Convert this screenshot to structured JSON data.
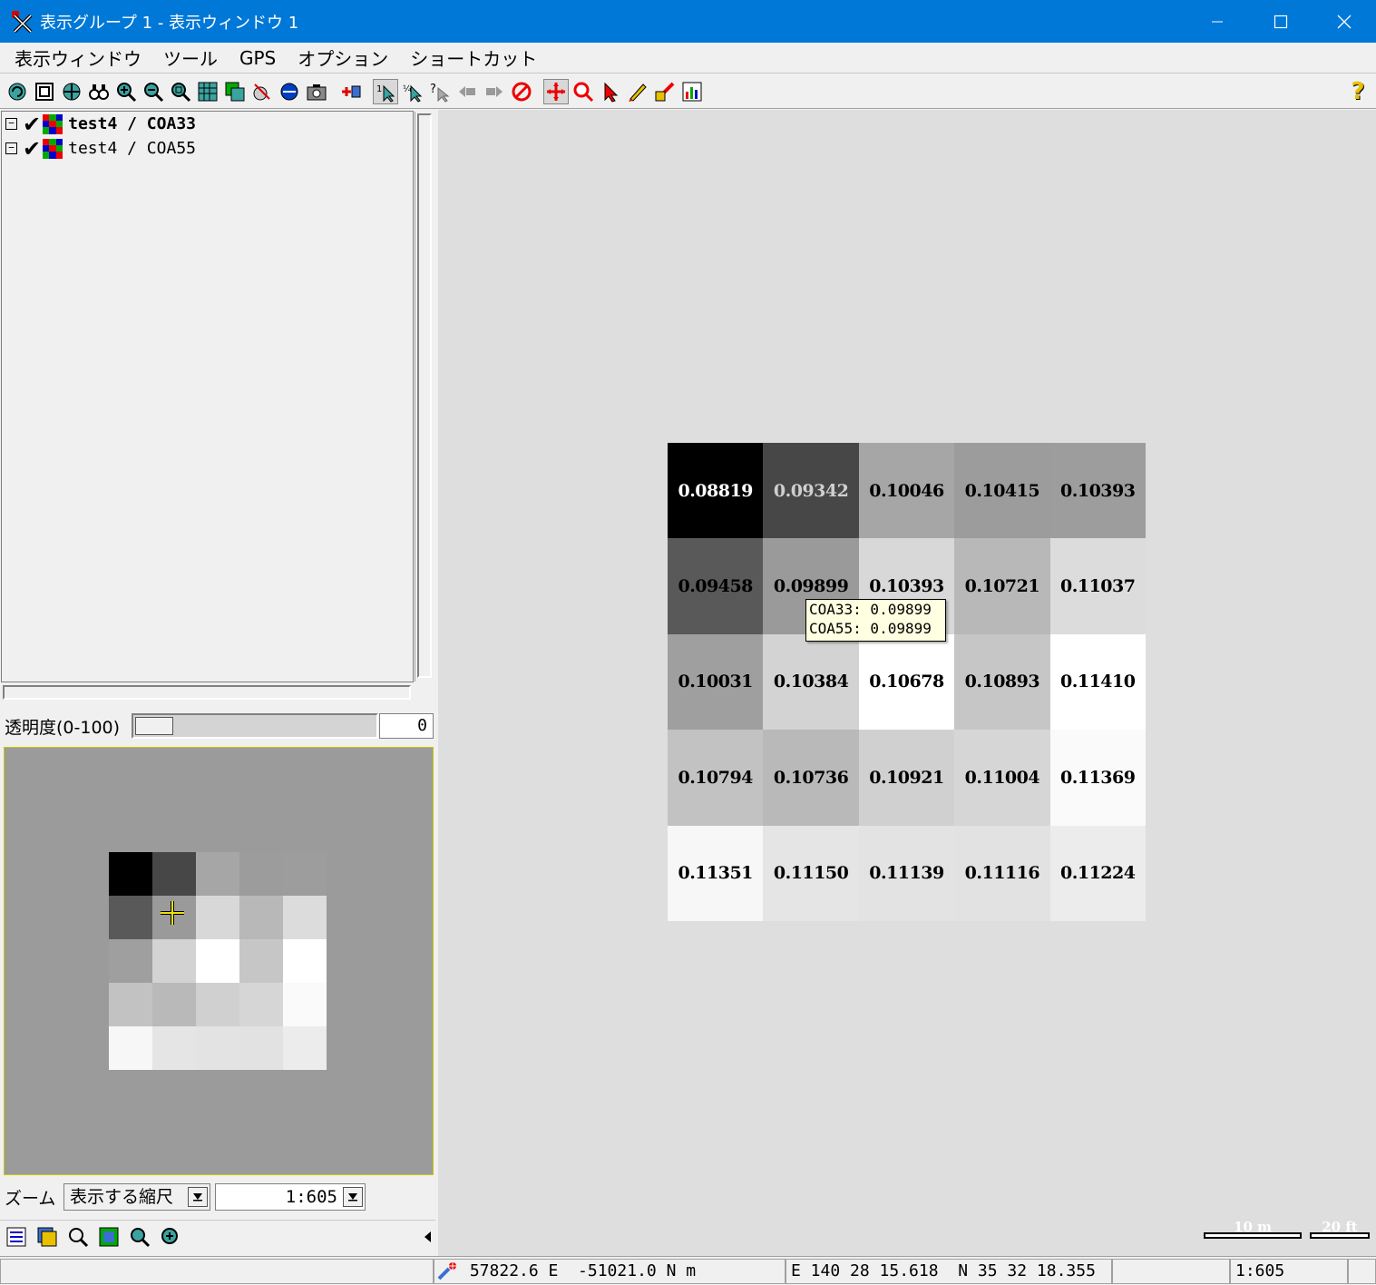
{
  "window": {
    "title": "表示グループ 1 - 表示ウィンドウ 1"
  },
  "menu": [
    "表示ウィンドウ",
    "ツール",
    "GPS",
    "オプション",
    "ショートカット"
  ],
  "layers": [
    {
      "label": "test4 / COA33",
      "checked": true,
      "bold": true
    },
    {
      "label": "test4 / COA55",
      "checked": true,
      "bold": false
    }
  ],
  "opacity": {
    "label": "透明度(0-100)",
    "value": "0"
  },
  "zoom": {
    "label": "ズーム",
    "mode": "表示する縮尺",
    "scale": "1:605"
  },
  "grid": {
    "values": [
      [
        "0.08819",
        "0.09342",
        "0.10046",
        "0.10415",
        "0.10393"
      ],
      [
        "0.09458",
        "0.09899",
        "0.10393",
        "0.10721",
        "0.11037"
      ],
      [
        "0.10031",
        "0.10384",
        "0.10678",
        "0.10893",
        "0.11410"
      ],
      [
        "0.10794",
        "0.10736",
        "0.10921",
        "0.11004",
        "0.11369"
      ],
      [
        "0.11351",
        "0.11150",
        "0.11139",
        "0.11116",
        "0.11224"
      ]
    ],
    "colors": [
      [
        "#000000",
        "#474747",
        "#a6a6a6",
        "#9c9c9c",
        "#9d9d9d"
      ],
      [
        "#595959",
        "#9a9a9a",
        "#d8d8d8",
        "#b8b8b8",
        "#dcdcdc"
      ],
      [
        "#9f9f9f",
        "#d3d3d3",
        "#ffffff",
        "#c6c6c6",
        "#ffffff"
      ],
      [
        "#c2c2c2",
        "#b9b9b9",
        "#d0d0d0",
        "#d6d6d6",
        "#fafafa"
      ],
      [
        "#f7f7f7",
        "#e5e5e5",
        "#e3e3e3",
        "#e2e2e2",
        "#ececec"
      ]
    ],
    "text_colors": [
      [
        "#ffffff",
        "#cfcfcf",
        "#000000",
        "#000000",
        "#000000"
      ],
      [
        "#000000",
        "#000000",
        "#000000",
        "#000000",
        "#000000"
      ],
      [
        "#000000",
        "#000000",
        "#000000",
        "#000000",
        "#000000"
      ],
      [
        "#000000",
        "#000000",
        "#000000",
        "#000000",
        "#000000"
      ],
      [
        "#000000",
        "#000000",
        "#000000",
        "#000000",
        "#000000"
      ]
    ],
    "overview_colors": [
      [
        "#000000",
        "#474747",
        "#a6a6a6",
        "#9c9c9c",
        "#9d9d9d"
      ],
      [
        "#595959",
        "#9a9a9a",
        "#d8d8d8",
        "#b8b8b8",
        "#dcdcdc"
      ],
      [
        "#9f9f9f",
        "#d3d3d3",
        "#ffffff",
        "#c6c6c6",
        "#ffffff"
      ],
      [
        "#c2c2c2",
        "#b9b9b9",
        "#d0d0d0",
        "#d6d6d6",
        "#fafafa"
      ],
      [
        "#f7f7f7",
        "#e5e5e5",
        "#e3e3e3",
        "#e2e2e2",
        "#ececec"
      ]
    ]
  },
  "tooltip": {
    "line1": "COA33: 0.09899",
    "line2": "COA55: 0.09899"
  },
  "scalebars": {
    "metric": "10 m",
    "imperial": "20 ft"
  },
  "status": {
    "projected": "57822.6 E  -51021.0 N m",
    "geographic": "E 140 28 15.618  N 35 32 18.355",
    "scale": "1:605"
  },
  "colors": {
    "titlebar": "#0078d7",
    "view_background": "#dedede",
    "overview_background": "#9b9b9b",
    "tooltip_background": "#ffffe1"
  }
}
